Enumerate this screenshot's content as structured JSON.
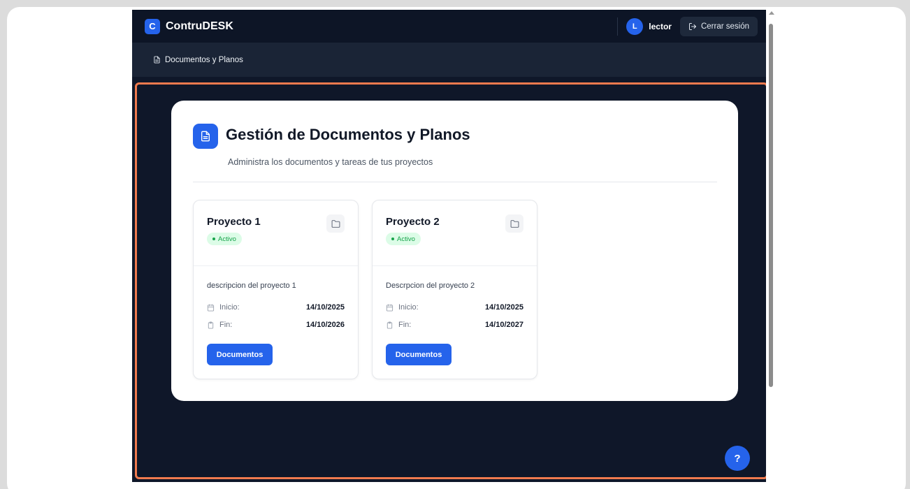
{
  "app": {
    "logo_letter": "C",
    "title": "ContruDESK"
  },
  "user": {
    "avatar_letter": "L",
    "name": "lector",
    "logout_label": "Cerrar sesión"
  },
  "breadcrumb": {
    "label": "Documentos y Planos"
  },
  "page": {
    "title": "Gestión de Documentos y Planos",
    "subtitle": "Administra los documentos y tareas de tus proyectos"
  },
  "projects": [
    {
      "name": "Proyecto 1",
      "status": "Activo",
      "description": "descripcion del proyecto 1",
      "start_label": "Inicio:",
      "start_date": "14/10/2025",
      "end_label": "Fin:",
      "end_date": "14/10/2026",
      "button_label": "Documentos"
    },
    {
      "name": "Proyecto 2",
      "status": "Activo",
      "description": "Descrpcion del proyecto 2",
      "start_label": "Inicio:",
      "start_date": "14/10/2025",
      "end_label": "Fin:",
      "end_date": "14/10/2027",
      "button_label": "Documentos"
    }
  ],
  "help": {
    "label": "?"
  },
  "colors": {
    "accent": "#2563eb",
    "app_background": "#0f1729",
    "highlight_outline": "#f07a4e",
    "status_active": "#16a34a"
  },
  "icons": {
    "breadcrumb": "document-icon",
    "title": "document-icon",
    "project": "folder-icon",
    "start": "calendar-icon",
    "end": "clipboard-icon",
    "logout": "logout-icon"
  }
}
